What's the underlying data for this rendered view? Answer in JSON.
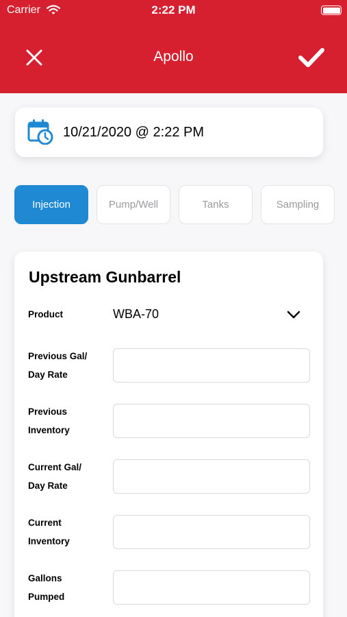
{
  "status_bar": {
    "carrier": "Carrier",
    "time": "2:22 PM"
  },
  "nav": {
    "title": "Apollo",
    "close_icon": "close-icon",
    "confirm_icon": "checkmark-icon"
  },
  "datetime": {
    "icon": "calendar-clock-icon",
    "value": "10/21/2020 @ 2:22 PM"
  },
  "tabs": [
    {
      "label": "Injection",
      "active": true
    },
    {
      "label": "Pump/Well",
      "active": false
    },
    {
      "label": "Tanks",
      "active": false
    },
    {
      "label": "Sampling",
      "active": false
    }
  ],
  "form": {
    "title": "Upstream Gunbarrel",
    "product": {
      "label": "Product",
      "value": "WBA-70"
    },
    "fields": [
      {
        "line1": "Previous Gal/",
        "line2": "Day Rate",
        "value": ""
      },
      {
        "line1": "Previous",
        "line2": "Inventory",
        "value": ""
      },
      {
        "line1": "Current Gal/",
        "line2": "Day Rate",
        "value": ""
      },
      {
        "line1": "Current",
        "line2": "Inventory",
        "value": ""
      },
      {
        "line1": "Gallons",
        "line2": "Pumped",
        "value": ""
      }
    ]
  },
  "colors": {
    "header": "#d61f2f",
    "active_tab": "#1f89d3",
    "calendar_icon": "#1f89d3"
  }
}
